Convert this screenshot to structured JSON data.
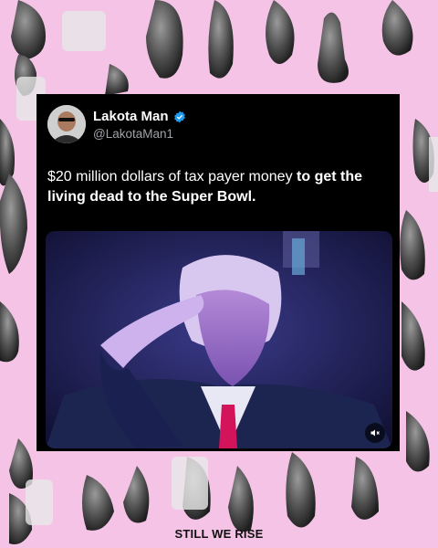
{
  "post": {
    "display_name": "Lakota Man",
    "handle": "@LakotaMan1",
    "text_regular": "$20 million dollars of tax payer money ",
    "text_bold": "to get the living dead to the Super Bowl.",
    "verified_icon": "verified-badge-icon",
    "verified_color": "#1d9bf0"
  },
  "media": {
    "mute_icon": "muted-speaker-icon"
  },
  "footer": {
    "brand": "STILL WE RISE"
  },
  "theme": {
    "background": "#f4c3e6",
    "card": "#000000"
  }
}
